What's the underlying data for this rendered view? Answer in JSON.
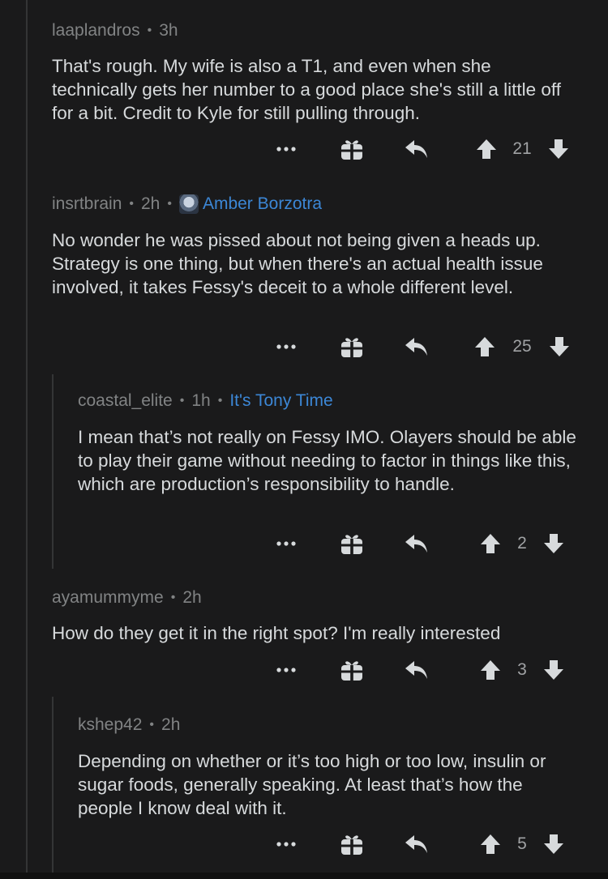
{
  "comments": [
    {
      "username": "laaplandros",
      "time": "3h",
      "flair": "",
      "body": "That's rough. My wife is also a T1, and even when she technically gets her number to a good place she's still a little off for a bit. Credit to Kyle for still pulling through.",
      "score": "21"
    },
    {
      "username": "insrtbrain",
      "time": "2h",
      "flair": "Amber Borzotra",
      "body": "No wonder he was pissed about not being given a heads up.  Strategy is one thing, but when there's an actual health issue involved, it takes Fessy's deceit to a whole different level.",
      "score": "25"
    },
    {
      "username": "coastal_elite",
      "time": "1h",
      "flair": "It's Tony Time",
      "body": "I mean that’s not really on Fessy IMO. Olayers should be able to play their game without needing to factor in things like this, which are production’s responsibility to handle.",
      "score": "2"
    },
    {
      "username": "ayamummyme",
      "time": "2h",
      "flair": "",
      "body": "How do they get it in the right spot? I'm really interested",
      "score": "3"
    },
    {
      "username": "kshep42",
      "time": "2h",
      "flair": "",
      "body": "Depending on whether or it’s too high or too low, insulin or sugar foods, generally speaking. At least that’s how the people I know deal with it.",
      "score": "5"
    }
  ],
  "icons": {
    "more": "more-options-icon",
    "award": "gift-award-icon",
    "reply": "reply-arrow-icon",
    "upvote": "upvote-arrow-icon",
    "downvote": "downvote-arrow-icon"
  },
  "colors": {
    "background": "#1a1a1b",
    "text": "#d7dadc",
    "meta": "#818384",
    "flair": "#3c87d6",
    "icon": "#d7dadc"
  }
}
